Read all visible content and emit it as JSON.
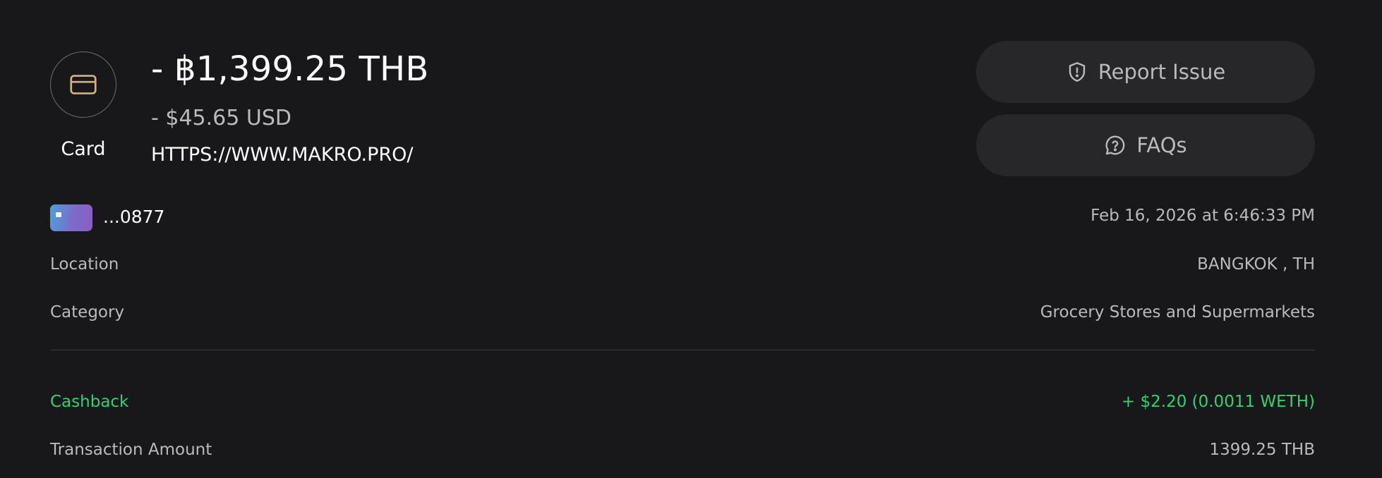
{
  "transaction": {
    "method_label": "Card",
    "amount_primary": "- ฿1,399.25 THB",
    "amount_secondary": "- $45.65 USD",
    "merchant": "HTTPS://WWW.MAKRO.PRO/"
  },
  "actions": {
    "report_label": "Report Issue",
    "faqs_label": "FAQs"
  },
  "card": {
    "last4": "...0877"
  },
  "details": {
    "datetime": "Feb 16, 2026 at 6:46:33 PM",
    "location_label": "Location",
    "location_value": "BANGKOK , TH",
    "category_label": "Category",
    "category_value": "Grocery Stores and Supermarkets",
    "cashback_label": "Cashback",
    "cashback_value": "+ $2.20 (0.0011 WETH)",
    "amount_label": "Transaction Amount",
    "amount_value": "1399.25 THB"
  },
  "colors": {
    "background": "#18181b",
    "button_bg": "#27272a",
    "accent_icon": "#d4b084",
    "cashback_green": "#31d175",
    "muted_text": "#b9b9be"
  },
  "icons": {
    "method": "credit-card-icon",
    "report": "shield-alert-icon",
    "faqs": "help-chat-icon"
  }
}
